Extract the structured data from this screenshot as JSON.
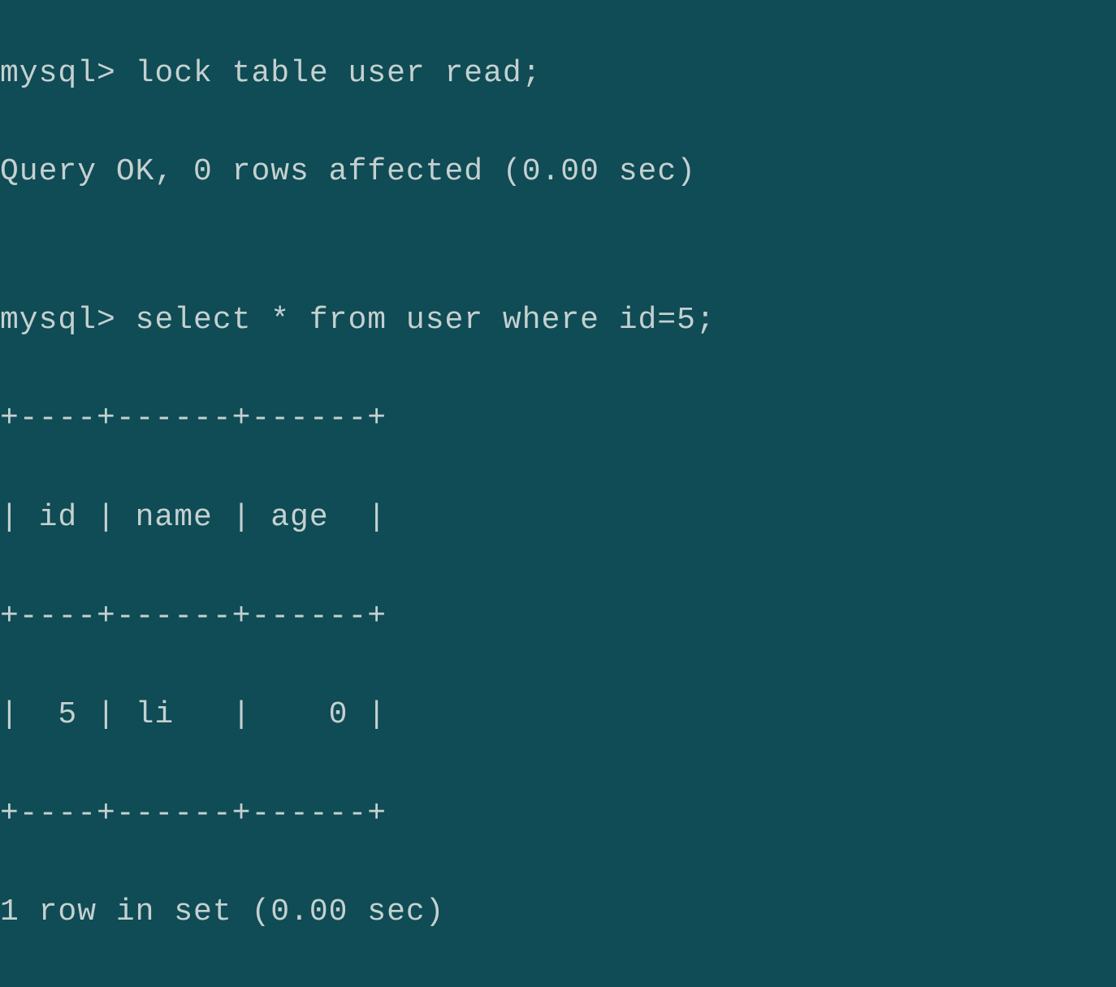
{
  "terminal": {
    "prompt": "mysql>",
    "lines": [
      {
        "prefix": "mysql> ",
        "text": "lock table user read;"
      },
      {
        "prefix": "",
        "text": "Query OK, 0 rows affected (0.00 sec)"
      },
      {
        "prefix": "",
        "text": ""
      },
      {
        "prefix": "mysql> ",
        "text": "select * from user where id=5;"
      },
      {
        "prefix": "",
        "text": "+----+------+------+"
      },
      {
        "prefix": "",
        "text": "| id | name | age  |"
      },
      {
        "prefix": "",
        "text": "+----+------+------+"
      },
      {
        "prefix": "",
        "text": "|  5 | li   |    0 |"
      },
      {
        "prefix": "",
        "text": "+----+------+------+"
      },
      {
        "prefix": "",
        "text": "1 row in set (0.00 sec)"
      }
    ],
    "commands": [
      "lock table user read;",
      "select * from user where id=5;"
    ],
    "query_result": {
      "status": "Query OK, 0 rows affected (0.00 sec)",
      "columns": [
        "id",
        "name",
        "age"
      ],
      "rows": [
        {
          "id": 5,
          "name": "li",
          "age": 0
        }
      ],
      "summary": "1 row in set (0.00 sec)"
    }
  },
  "colors": {
    "background": "#0f4c55",
    "foreground": "#c5d0d0"
  }
}
